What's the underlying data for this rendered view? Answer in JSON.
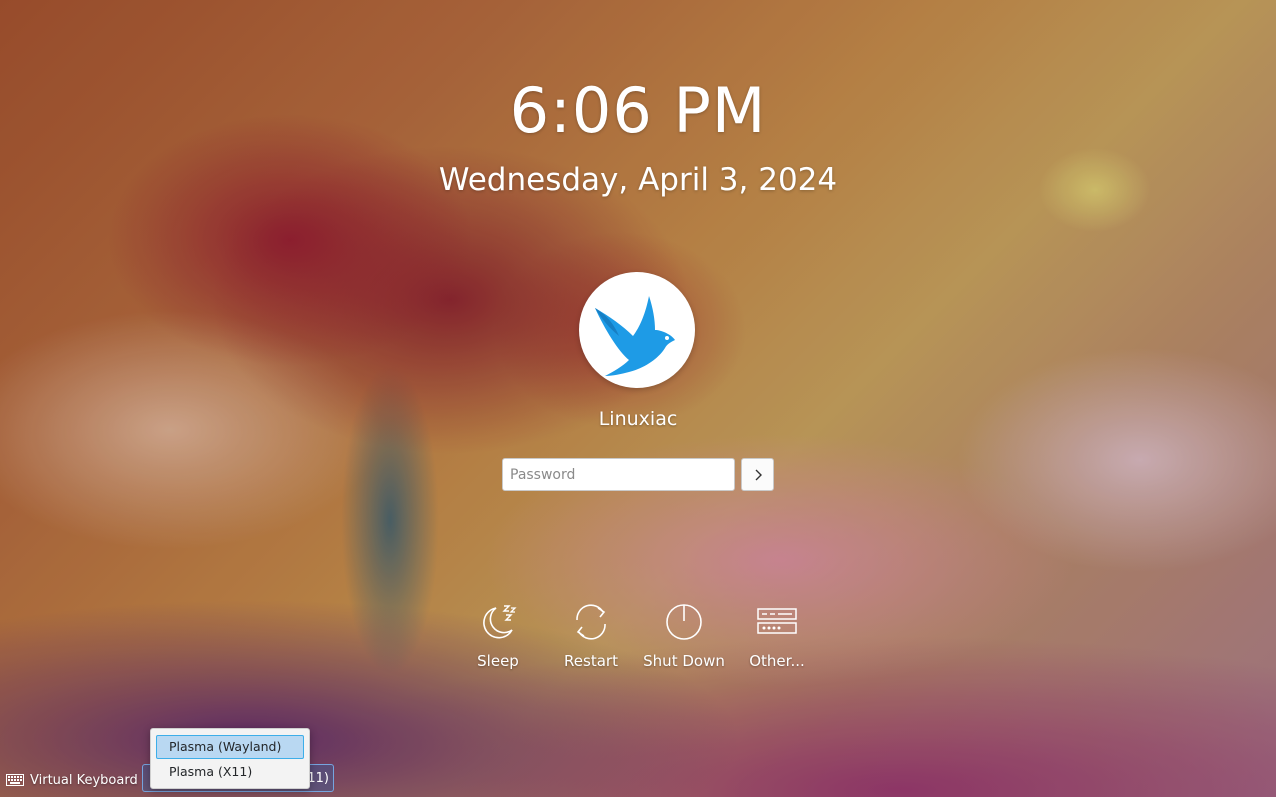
{
  "clock": {
    "time": "6:06 PM",
    "date": "Wednesday, April 3, 2024"
  },
  "user": {
    "name": "Linuxiac",
    "avatar_icon": "bird-logo-icon"
  },
  "login": {
    "password_placeholder": "Password",
    "submit_icon": "chevron-right-icon"
  },
  "actions": [
    {
      "id": "sleep",
      "label": "Sleep",
      "icon": "sleep-icon"
    },
    {
      "id": "restart",
      "label": "Restart",
      "icon": "restart-icon"
    },
    {
      "id": "shutdown",
      "label": "Shut Down",
      "icon": "power-icon"
    },
    {
      "id": "other",
      "label": "Other...",
      "icon": "other-icon"
    }
  ],
  "bottom": {
    "virtual_keyboard": "Virtual Keyboard",
    "session_combo_visible": "11)",
    "session_options": [
      {
        "label": "Plasma (Wayland)",
        "selected": true
      },
      {
        "label": "Plasma (X11)",
        "selected": false
      }
    ]
  },
  "colors": {
    "accent": "#3daee9",
    "avatar_bird": "#1e9be6"
  }
}
